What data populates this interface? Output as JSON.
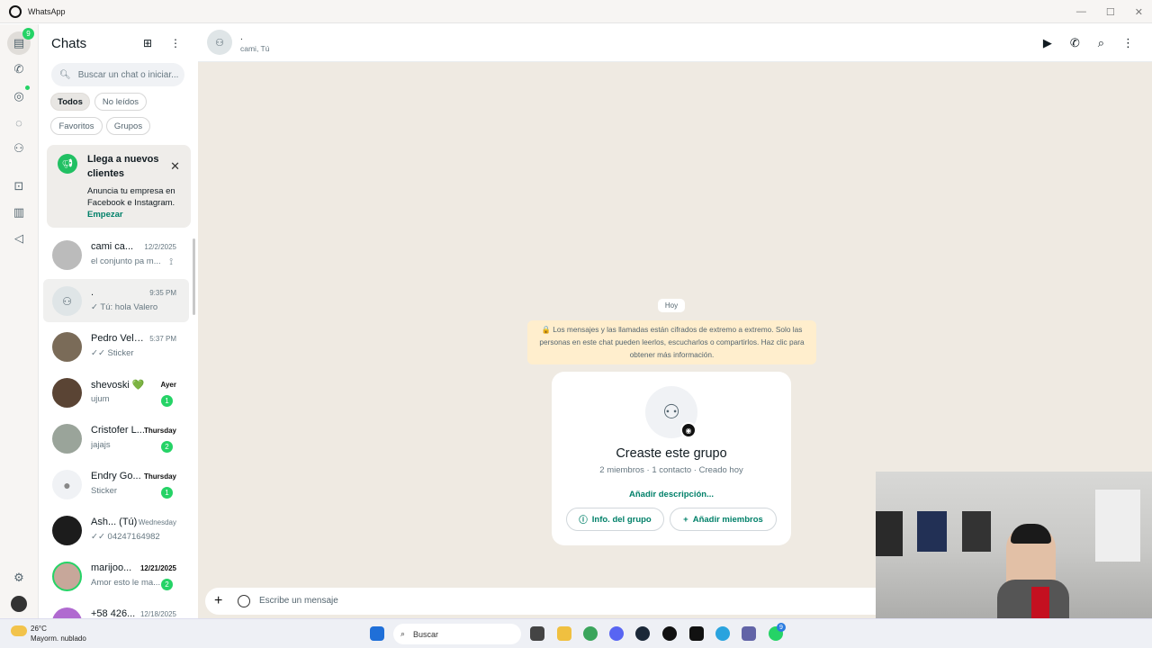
{
  "app": {
    "title": "WhatsApp"
  },
  "rail": {
    "badge": "9"
  },
  "left": {
    "title": "Chats",
    "search_placeholder": "Buscar un chat o iniciar...",
    "chips": [
      "Todos",
      "No leídos",
      "Favoritos",
      "Grupos"
    ],
    "promo": {
      "title": "Llega a nuevos clientes",
      "body": "Anuncia tu empresa en Facebook e Instagram.",
      "link": "Empezar"
    },
    "chats": [
      {
        "name": "cami ca...",
        "time": "12/2/2025",
        "preview": "el conjunto pa m...",
        "pinned": true,
        "bold_time": false,
        "unread": ""
      },
      {
        "name": ".",
        "time": "9:35 PM",
        "preview": "✓ Tú: hola Valero",
        "pinned": false,
        "bold_time": false,
        "unread": ""
      },
      {
        "name": "Pedro Vela...",
        "time": "5:37 PM",
        "preview": "✓✓ Sticker",
        "pinned": false,
        "bold_time": false,
        "unread": ""
      },
      {
        "name": "shevoski 💚",
        "time": "Ayer",
        "preview": "ujum",
        "pinned": false,
        "bold_time": true,
        "unread": "1"
      },
      {
        "name": "Cristofer L...",
        "time": "Thursday",
        "preview": "jajajs",
        "pinned": false,
        "bold_time": true,
        "unread": "2"
      },
      {
        "name": "Endry Go...",
        "time": "Thursday",
        "preview": "Sticker",
        "pinned": false,
        "bold_time": true,
        "unread": "1"
      },
      {
        "name": "Ash... (Tú)",
        "time": "Wednesday",
        "preview": "✓✓ 04247164982",
        "pinned": false,
        "bold_time": false,
        "unread": ""
      },
      {
        "name": "marijoo...",
        "time": "12/21/2025",
        "preview": "Amor esto le ma...",
        "pinned": false,
        "bold_time": true,
        "unread": "2"
      },
      {
        "name": "+58 426...",
        "time": "12/18/2025",
        "preview": "",
        "pinned": false,
        "bold_time": false,
        "unread": ""
      }
    ]
  },
  "conversation": {
    "title": ".",
    "subtitle": "cami, Tú",
    "date_pill": "Hoy",
    "encryption_notice": "🔒 Los mensajes y las llamadas están cifrados de extremo a extremo. Solo las personas en este chat pueden leerlos, escucharlos o compartirlos. Haz clic para obtener más información.",
    "card": {
      "title": "Creaste este grupo",
      "meta": "2 miembros · 1 contacto · Creado hoy",
      "desc_link": "Añadir descripción...",
      "info_button": "Info. del grupo",
      "add_button": "Añadir miembros"
    },
    "compose_placeholder": "Escribe un mensaje"
  },
  "taskbar": {
    "temp": "26°C",
    "weather": "Mayorm. nublado",
    "search": "Buscar",
    "whatsapp_badge": "9"
  }
}
